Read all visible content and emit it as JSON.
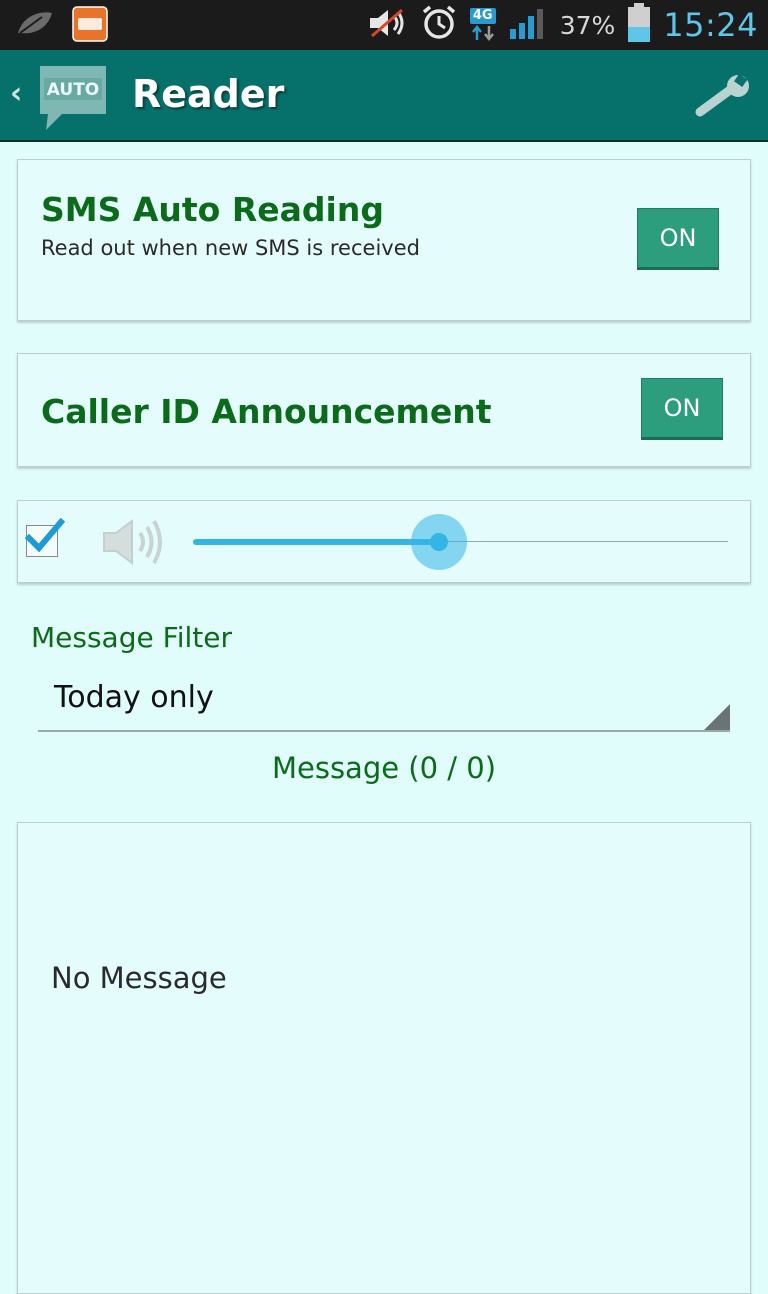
{
  "status_bar": {
    "battery_percent": "37%",
    "time": "15:24",
    "network": "4G",
    "icons": [
      "leaf-icon",
      "xda-deals-icon",
      "mute-icon",
      "alarm-icon",
      "network-4g-icon",
      "signal-icon",
      "battery-icon"
    ]
  },
  "app_bar": {
    "title": "Reader",
    "logo_text": "AUTO",
    "back_icon": "chevron-left-icon",
    "settings_icon": "wrench-icon"
  },
  "sms_card": {
    "title": "SMS Auto Reading",
    "subtitle": "Read out when new SMS is received",
    "toggle_label": "ON"
  },
  "caller_card": {
    "title": "Caller ID Announcement",
    "toggle_label": "ON"
  },
  "volume_card": {
    "checkbox_checked": true,
    "level": 0.46,
    "icon": "speaker-icon"
  },
  "filter": {
    "label": "Message Filter",
    "selected": "Today only"
  },
  "messages": {
    "count_label": "Message (0 / 0)",
    "empty_text": "No Message"
  },
  "colors": {
    "app_bar": "#06716b",
    "background": "#e1fdfb",
    "accent_green": "#0b6b1b",
    "toggle": "#2c9d7d",
    "slider": "#33b5e5"
  }
}
